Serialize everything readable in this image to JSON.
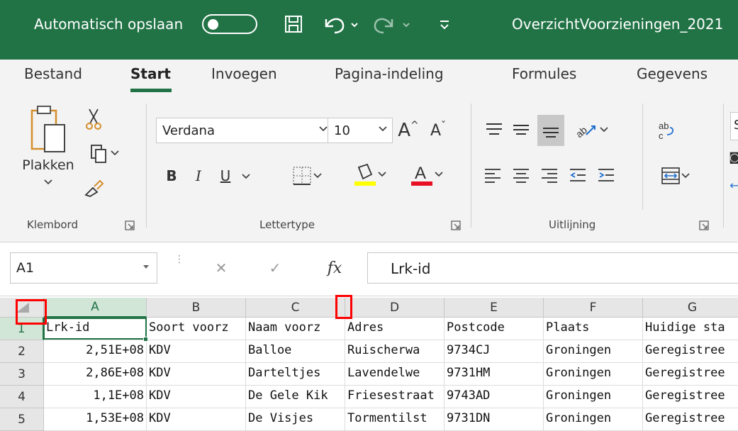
{
  "titlebar": {
    "autosave_label": "Automatisch opslaan",
    "filename": "OverzichtVoorzieningen_2021",
    "toggle_state": "off"
  },
  "tabs": [
    "Bestand",
    "Start",
    "Invoegen",
    "Pagina-indeling",
    "Formules",
    "Gegevens"
  ],
  "active_tab": "Start",
  "ribbon": {
    "paste_label": "Plakken",
    "group_clipboard": "Klembord",
    "group_font": "Lettertype",
    "group_alignment": "Uitlijning",
    "font_name": "Verdana",
    "font_size": "10",
    "bold": "B",
    "italic": "I",
    "underline": "U",
    "styles_partial": "S"
  },
  "formula_bar": {
    "name_box": "A1",
    "fx": "fx",
    "content": "Lrk-id"
  },
  "grid": {
    "columns": [
      "A",
      "B",
      "C",
      "D",
      "E",
      "F",
      "G"
    ],
    "rows": [
      [
        "Lrk-id",
        "Soort voorz",
        "Naam voorz",
        "Adres",
        "Postcode",
        "Plaats",
        "Huidige sta"
      ],
      [
        "2,51E+08",
        "KDV",
        "Balloe",
        "Ruischerwa",
        "9734CJ",
        "Groningen",
        "Geregistree"
      ],
      [
        "2,86E+08",
        "KDV",
        "Darteltjes",
        "Lavendelwe",
        "9731HM",
        "Groningen",
        "Geregistree"
      ],
      [
        "1,1E+08",
        "KDV",
        "De Gele Kik",
        "Friesestraat",
        "9743AD",
        "Groningen",
        "Geregistree"
      ],
      [
        "1,53E+08",
        "KDV",
        "De Visjes",
        "Tormentilst",
        "9731DN",
        "Groningen",
        "Geregistree"
      ]
    ],
    "row_numbers": [
      "1",
      "2",
      "3",
      "4",
      "5"
    ]
  },
  "colors": {
    "excel_green": "#217346",
    "highlight_red": "#ff0000",
    "font_color_bar": "#e81123",
    "highlight_yellow": "#ffff00"
  }
}
